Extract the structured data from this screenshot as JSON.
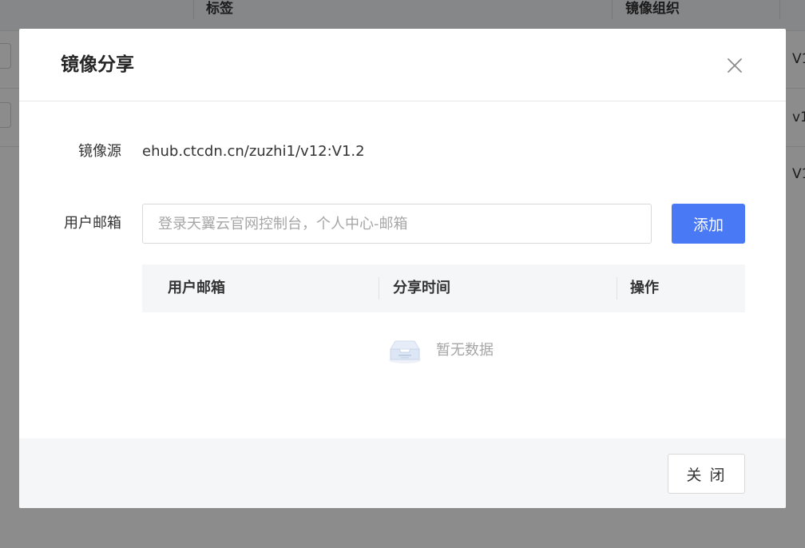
{
  "background_table": {
    "columns": [
      "标签",
      "镜像组织"
    ],
    "row_values": [
      "V1",
      "v1",
      "V1"
    ]
  },
  "modal": {
    "title": "镜像分享",
    "source": {
      "label": "镜像源",
      "value": "ehub.ctcdn.cn/zuzhi1/v12:V1.2"
    },
    "email": {
      "label": "用户邮箱",
      "value": "",
      "placeholder": "登录天翼云官网控制台，个人中心-邮箱",
      "add_label": "添加"
    },
    "table": {
      "headers": [
        "用户邮箱",
        "分享时间",
        "操作"
      ],
      "rows": [],
      "empty_text": "暂无数据",
      "empty_icon": "empty-inbox-icon"
    },
    "footer": {
      "close_label": "关 闭"
    },
    "close_icon": "close-icon"
  },
  "colors": {
    "primary": "#4a79f5",
    "overlay": "rgba(0,0,0,0.45)",
    "footer_bg": "#f5f6f8"
  }
}
